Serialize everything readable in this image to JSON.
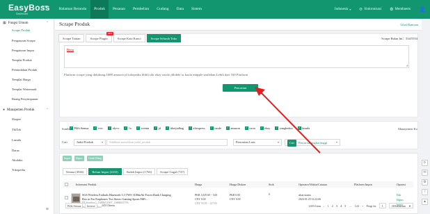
{
  "app": {
    "logo": "EasyBoss",
    "logo_sup": "com",
    "logo_sub": "Dashboard"
  },
  "nav": [
    {
      "label": "Halaman Beranda",
      "active": false
    },
    {
      "label": "Produk",
      "active": true
    },
    {
      "label": "Pesanan",
      "active": false
    },
    {
      "label": "Pembelian",
      "active": false
    },
    {
      "label": "Gudang",
      "active": false
    },
    {
      "label": "Data",
      "active": false
    },
    {
      "label": "Sistem",
      "active": false
    }
  ],
  "topright": {
    "language": "Indonesia",
    "sync": "Sinkronisasi",
    "member": "Membaerts"
  },
  "sidebar": {
    "group1": "Fungsi Umum",
    "items1": [
      "Scrape Produk",
      "Pengaturan Scrape",
      "Pengaturan Impor",
      "Templat Produk",
      "Pemindahan Produk",
      "Templat Harga",
      "Templat Watermark",
      "Ruang Penyimpanan"
    ],
    "group2": "Manajemen Produk",
    "items2": [
      "Shopee",
      "TikTok",
      "Lazada",
      "Daraz",
      "Akulaku",
      "Tokopedia"
    ]
  },
  "page": {
    "title": "Scrape Produk",
    "help": "Lihat Bantuan",
    "quota": "Scrape Bulan Ini：534/5554"
  },
  "scrape_tabs": [
    {
      "label": "Scrape Tautan",
      "active": false
    },
    {
      "label": "Scrape Plugin",
      "active": false,
      "badge": "HOT"
    },
    {
      "label": "Scrape Kata Kunci",
      "active": false
    },
    {
      "label": "Scrape Seluruh Toko",
      "active": true
    }
  ],
  "textarea_placeholder": "Bissu",
  "platform_note": "Platform scrape yang didukung:1688  amazon  jd  tokopedia  blibli  tiki  ebay  oazdo  jdlobde  ss  kaola  mupple  smilahan Lebih dari 160 Platform",
  "search_button": "Pencarian",
  "filter": {
    "source_label": "Sumber",
    "checkboxes": [
      "Pilih Semua",
      "vvic",
      "alyvv",
      "1x",
      "xvenin",
      "jd",
      "tiketjialbag",
      "aliexpress",
      "oasde",
      "amazon",
      "ozon",
      "ebay",
      "yangkeduo",
      "lazada"
    ],
    "manage_col": "Manajemen Ko",
    "cari_label": "Cari",
    "field_select": "Judul Produk",
    "keyword_placeholder": "Silahkan masukkan judul produk",
    "match_select": "Pencarian Luas",
    "cari_button": "Cari",
    "advanced": "Pencarian tingkat tinggi"
  },
  "actions": [
    "Impor",
    "Hapus",
    "Cetak Ulang"
  ],
  "sub_tabs": [
    {
      "label": "Semua (4946)",
      "active": false
    },
    {
      "label": "Belum Impor (2433)",
      "active": true
    },
    {
      "label": "Sudah Impor (1766)",
      "active": false
    },
    {
      "label": "Scrape Gagal (747)",
      "active": false
    }
  ],
  "table": {
    "headers": [
      "Informasi Produk",
      "Harga",
      "Harga Diskon",
      "Stok",
      "Operator/Waktu/Catatan",
      "Platform Impor",
      "Operasi"
    ],
    "row": {
      "title": "SGS Wireless Earbuds Bluetooth 5.3 TWS 3100mAh Power Bank Charging Box in Ear Earphones Tws Stereo Gaming Sports HiFi…",
      "id": "ID Sumber：1688651007_1688655793",
      "source": "Sumber：  daloo",
      "price": "PKR 1,029.00 ~ 3.00",
      "price2": "CNY 0.00",
      "price3": "CNY 55.91 ~ 127.93",
      "discount": "PKR 0.00",
      "discount2": "CNY 0.00",
      "stock": "0",
      "operator": "akun utama",
      "time": "2024-01-25 16:12:06",
      "ops": [
        "Edit",
        "Hapus",
        "Impor"
      ]
    }
  },
  "bottom": {
    "select_all": "Pilih Semua",
    "invert": "Inverse",
    "count": "2433 Items",
    "total": "2433 Item",
    "pages": [
      "1",
      "2",
      "3",
      "4",
      "5",
      "…",
      "122",
      ">"
    ],
    "goto": "Pergi ke",
    "page_input": "1",
    "per_page": "20/halaman"
  }
}
